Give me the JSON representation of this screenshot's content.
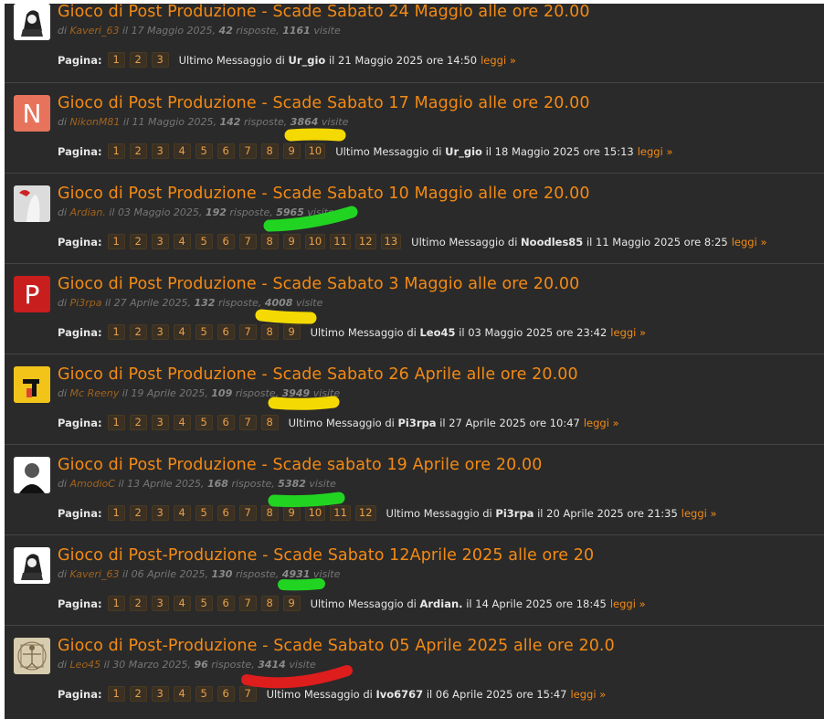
{
  "threads": [
    {
      "title": "Gioco di Post Produzione - Scade Sabato 24 Maggio alle ore 20.00",
      "author": "Kaveri_63",
      "date": "il 17 Maggio 2025",
      "replies": "42",
      "views": "1161",
      "pages": [
        "1",
        "2",
        "3"
      ],
      "last_user": "Ur_gio",
      "last_date": "il 21 Maggio 2025 ore 14:50",
      "avatar_letter": "",
      "avatar_color": "#ffffff"
    },
    {
      "title": "Gioco di Post Produzione - Scade Sabato 17 Maggio alle ore 20.00",
      "author": "NikonM81",
      "date": "il 11 Maggio 2025",
      "replies": "142",
      "views": "3864",
      "pages": [
        "1",
        "2",
        "3",
        "4",
        "5",
        "6",
        "7",
        "8",
        "9",
        "10"
      ],
      "last_user": "Ur_gio",
      "last_date": "il 18 Maggio 2025 ore 15:13",
      "avatar_letter": "N",
      "avatar_color": "#e8735c"
    },
    {
      "title": "Gioco di Post Produzione - Scade Sabato 10 Maggio alle ore 20.00",
      "author": "Ardian.",
      "date": "il 03 Maggio 2025",
      "replies": "192",
      "views": "5965",
      "pages": [
        "1",
        "2",
        "3",
        "4",
        "5",
        "6",
        "7",
        "8",
        "9",
        "10",
        "11",
        "12",
        "13"
      ],
      "last_user": "Noodles85",
      "last_date": "il 11 Maggio 2025 ore 8:25",
      "avatar_letter": "",
      "avatar_color": "#cfcfcf"
    },
    {
      "title": "Gioco di Post Produzione - Scade Sabato 3 Maggio alle ore 20.00",
      "author": "Pi3rpa",
      "date": "il 27 Aprile 2025",
      "replies": "132",
      "views": "4008",
      "pages": [
        "1",
        "2",
        "3",
        "4",
        "5",
        "6",
        "7",
        "8",
        "9"
      ],
      "last_user": "Leo45",
      "last_date": "il 03 Maggio 2025 ore 23:42",
      "avatar_letter": "P",
      "avatar_color": "#c81e1e"
    },
    {
      "title": "Gioco di Post Produzione - Scade Sabato 26 Aprile alle ore 20.00",
      "author": "Mc Reeny",
      "date": "il 19 Aprile 2025",
      "replies": "109",
      "views": "3949",
      "pages": [
        "1",
        "2",
        "3",
        "4",
        "5",
        "6",
        "7",
        "8"
      ],
      "last_user": "Pi3rpa",
      "last_date": "il 27 Aprile 2025 ore 10:47",
      "avatar_letter": "",
      "avatar_color": "#f2c41a"
    },
    {
      "title": "Gioco di Post Produzione - Scade sabato 19 Aprile ore 20.00",
      "author": "AmodioC",
      "date": "il 13 Aprile 2025",
      "replies": "168",
      "views": "5382",
      "pages": [
        "1",
        "2",
        "3",
        "4",
        "5",
        "6",
        "7",
        "8",
        "9",
        "10",
        "11",
        "12"
      ],
      "last_user": "Pi3rpa",
      "last_date": "il 20 Aprile 2025 ore 21:35",
      "avatar_letter": "",
      "avatar_color": "#ffffff"
    },
    {
      "title": "Gioco di Post-Produzione - Scade Sabato 12Aprile 2025 alle ore 20",
      "author": "Kaveri_63",
      "date": "il 06 Aprile 2025",
      "replies": "130",
      "views": "4931",
      "pages": [
        "1",
        "2",
        "3",
        "4",
        "5",
        "6",
        "7",
        "8",
        "9"
      ],
      "last_user": "Ardian.",
      "last_date": "il 14 Aprile 2025 ore 18:45",
      "avatar_letter": "",
      "avatar_color": "#ffffff"
    },
    {
      "title": "Gioco di Post-Produzione - Scade Sabato 05 Aprile 2025 alle ore 20.0",
      "author": "Leo45",
      "date": "il 30 Marzo 2025",
      "replies": "96",
      "views": "3414",
      "pages": [
        "1",
        "2",
        "3",
        "4",
        "5",
        "6",
        "7"
      ],
      "last_user": "Ivo6767",
      "last_date": "il 06 Aprile 2025 ore 15:47",
      "avatar_letter": "",
      "avatar_color": "#d8ccae"
    }
  ],
  "labels": {
    "by": "di",
    "replies": "risposte",
    "views": "visite",
    "pagina": "Pagina:",
    "last_message": "Ultimo Messaggio di",
    "read": "leggi »"
  },
  "highlight_colors": {
    "yellow": "#ffe400",
    "green": "#22dd22",
    "red": "#e81c1c"
  }
}
